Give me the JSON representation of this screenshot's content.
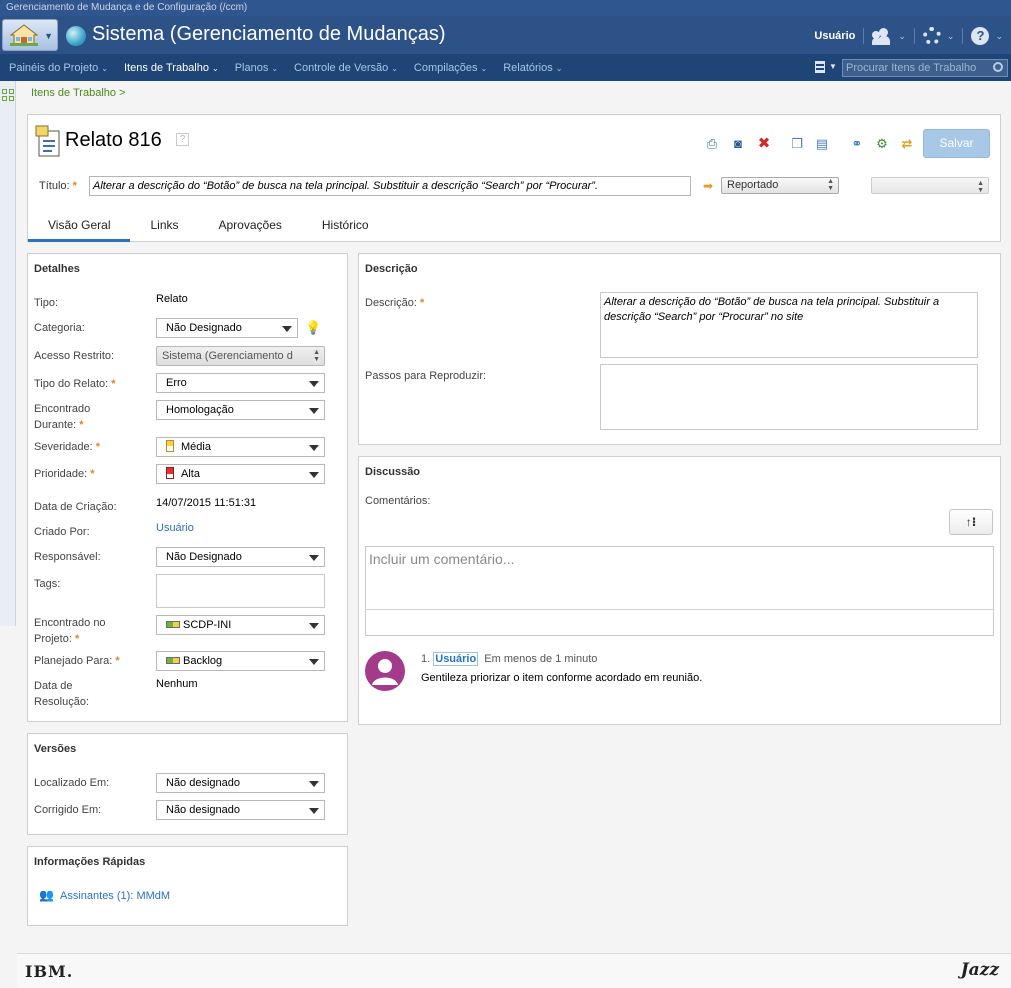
{
  "app": {
    "top_strip": "Gerenciamento de Mudança e de Configuração (/ccm)",
    "title": "Sistema (Gerenciamento de Mudanças)",
    "user_label": "Usuário"
  },
  "menu": {
    "items": [
      "Painéis do Projeto",
      "Itens de Trabalho",
      "Planos",
      "Controle de Versão",
      "Compilações",
      "Relatórios"
    ],
    "search_placeholder": "Procurar Itens de Trabalho"
  },
  "breadcrumb": "Itens de Trabalho >",
  "work_item": {
    "heading": "Relato 816",
    "help_glyph": "?",
    "title_label": "Título:",
    "title_value": "Alterar a descrição do “Botão” de busca na tela principal. Substituir a descrição “Search” por “Procurar”.",
    "state": "Reportado",
    "save_label": "Salvar",
    "tabs": [
      "Visão Geral",
      "Links",
      "Aprovações",
      "Histórico"
    ]
  },
  "details": {
    "heading": "Detalhes",
    "tipo_label": "Tipo:",
    "tipo_value": "Relato",
    "categoria_label": "Categoria:",
    "categoria_value": "Não Designado",
    "acesso_label": "Acesso Restrito:",
    "acesso_value": "Sistema (Gerenciamento d",
    "tipo_relato_label": "Tipo do Relato:",
    "tipo_relato_value": "Erro",
    "encontrado_durante_label_1": "Encontrado",
    "encontrado_durante_label_2": "Durante:",
    "encontrado_durante_value": "Homologação",
    "severidade_label": "Severidade:",
    "severidade_value": "Média",
    "prioridade_label": "Prioridade:",
    "prioridade_value": "Alta",
    "data_criacao_label": "Data de Criação:",
    "data_criacao_value": "14/07/2015 11:51:31",
    "criado_por_label": "Criado Por:",
    "criado_por_value": "Usuário",
    "responsavel_label": "Responsável:",
    "responsavel_value": "Não Designado",
    "tags_label": "Tags:",
    "projeto_label_1": "Encontrado no",
    "projeto_label_2": "Projeto:",
    "projeto_value": "SCDP-INI",
    "planejado_label": "Planejado Para:",
    "planejado_value": "Backlog",
    "resolucao_label_1": "Data de",
    "resolucao_label_2": "Resolução:",
    "resolucao_value": "Nenhum"
  },
  "versions": {
    "heading": "Versões",
    "localizado_label": "Localizado Em:",
    "localizado_value": "Não designado",
    "corrigido_label": "Corrigido Em:",
    "corrigido_value": "Não designado"
  },
  "quick_info": {
    "heading": "Informações Rápidas",
    "subscribers": "Assinantes (1):",
    "subscriber_name": "MMdM"
  },
  "description": {
    "heading": "Descrição",
    "desc_label": "Descrição:",
    "desc_value": "Alterar a descrição do “Botão” de busca na tela principal. Substituir a descrição “Search” por “Procurar” no site",
    "steps_label": "Passos para Reproduzir:"
  },
  "discussion": {
    "heading": "Discussão",
    "comments_label": "Comentários:",
    "comment_placeholder": "Incluir um comentário...",
    "comment_index": "1.",
    "comment_author": "Usuário",
    "comment_time": "Em menos de 1 minuto",
    "comment_text": "Gentileza priorizar o item conforme acordado em reunião."
  },
  "footer": {
    "left_logo": "IBM.",
    "right_logo": "Jazz"
  },
  "colors": {
    "header_bg": "#2d5288",
    "menu_bg": "#1f4476",
    "link": "#2a71c2",
    "required": "#e8801a",
    "save_button": "#a8c8e8"
  }
}
